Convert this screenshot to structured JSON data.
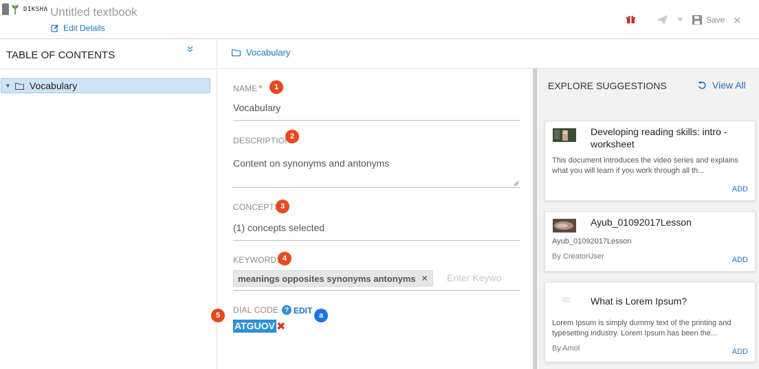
{
  "header": {
    "logo_text": "DIKSHA",
    "title": "Untitled textbook",
    "edit_details": "Edit Details",
    "save_label": "Save"
  },
  "toc": {
    "title": "TABLE OF CONTENTS",
    "items": [
      {
        "label": "Vocabulary"
      }
    ]
  },
  "breadcrumb": {
    "label": "Vocabulary"
  },
  "form": {
    "name": {
      "label": "NAME",
      "required_mark": "*",
      "value": "Vocabulary",
      "badge": "1"
    },
    "description": {
      "label": "DESCRIPTION",
      "value": "Content on synonyms and antonyms",
      "badge": "2"
    },
    "concepts": {
      "label": "CONCEPTS",
      "value": "(1) concepts selected",
      "badge": "3"
    },
    "keywords": {
      "label": "KEYWORDS",
      "chip": "meanings opposites synonyms antonyms",
      "placeholder": "Enter Keywo",
      "badge": "4"
    },
    "dial_code": {
      "label": "DIAL CODE",
      "help": "?",
      "edit": "EDIT",
      "value": "ATGUOV",
      "badge": "5",
      "badge_a": "a"
    }
  },
  "explore": {
    "title": "EXPLORE SUGGESTIONS",
    "view_all": "View All",
    "cards": [
      {
        "title": "Developing reading skills: intro - worksheet",
        "description": "This document introduces the video series and explains what you will learn if you work through all th...",
        "add": "ADD"
      },
      {
        "title": "Ayub_01092017Lesson",
        "description": "Ayub_01092017Lesson",
        "by": "By CreatorUser",
        "add": "ADD"
      },
      {
        "title": "What is Lorem Ipsum?",
        "description": "Lorem Ipsum is simply dummy text of the printing and typesetting industry. Lorem Ipsum has been the...",
        "by": "By Amol",
        "add": "ADD"
      }
    ]
  },
  "colors": {
    "accent": "#1a73c2",
    "badge": "#e8491d",
    "selection": "#cfe3f7",
    "dial_highlight": "#2f8fd8"
  }
}
